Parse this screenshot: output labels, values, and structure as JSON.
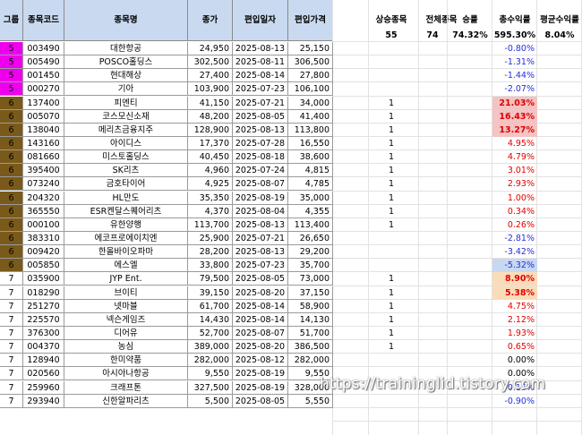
{
  "headers": {
    "group": "그룹",
    "code": "종목코드",
    "name": "종목명",
    "close": "종가",
    "date": "편입일자",
    "entry": "편입가격"
  },
  "summary": {
    "labels": [
      "상승종목",
      "전체종목",
      "승률",
      "총수익률",
      "평균수익률"
    ],
    "values": [
      "55",
      "74",
      "74.32%",
      "595.30%",
      "8.04%"
    ]
  },
  "colors": {
    "header_bg": "#c9daf0",
    "group5": "#ee00ee",
    "group6": "#7a5a1a",
    "pink_highlight": "#f4c3c3",
    "orange_highlight": "#fbdcb8",
    "blue_highlight": "#c8d8f0",
    "positive": "#e00000",
    "negative": "#2330d8"
  },
  "rows": [
    {
      "group": "5",
      "code": "003490",
      "name": "대한항공",
      "close": "24,950",
      "date": "2025-08-13",
      "entry": "25,150",
      "up": "",
      "ret": "-0.80%",
      "sign": "neg",
      "hl": ""
    },
    {
      "group": "5",
      "code": "005490",
      "name": "POSCO홀딩스",
      "close": "302,500",
      "date": "2025-08-11",
      "entry": "306,500",
      "up": "",
      "ret": "-1.31%",
      "sign": "neg",
      "hl": ""
    },
    {
      "group": "5",
      "code": "001450",
      "name": "현대해상",
      "close": "27,400",
      "date": "2025-08-14",
      "entry": "27,800",
      "up": "",
      "ret": "-1.44%",
      "sign": "neg",
      "hl": ""
    },
    {
      "group": "5",
      "code": "000270",
      "name": "기아",
      "close": "103,900",
      "date": "2025-07-23",
      "entry": "106,100",
      "up": "",
      "ret": "-2.07%",
      "sign": "neg",
      "hl": ""
    },
    {
      "group": "6",
      "code": "137400",
      "name": "피엔티",
      "close": "41,150",
      "date": "2025-07-21",
      "entry": "34,000",
      "up": "1",
      "ret": "21.03%",
      "sign": "pos",
      "hl": "pink"
    },
    {
      "group": "6",
      "code": "005070",
      "name": "코스모신소재",
      "close": "48,200",
      "date": "2025-08-05",
      "entry": "41,400",
      "up": "1",
      "ret": "16.43%",
      "sign": "pos",
      "hl": "pink"
    },
    {
      "group": "6",
      "code": "138040",
      "name": "메리츠금융지주",
      "close": "128,900",
      "date": "2025-08-13",
      "entry": "113,800",
      "up": "1",
      "ret": "13.27%",
      "sign": "pos",
      "hl": "pink"
    },
    {
      "group": "6",
      "code": "143160",
      "name": "아이디스",
      "close": "17,370",
      "date": "2025-07-28",
      "entry": "16,550",
      "up": "1",
      "ret": "4.95%",
      "sign": "pos",
      "hl": ""
    },
    {
      "group": "6",
      "code": "081660",
      "name": "미스토홀딩스",
      "close": "40,450",
      "date": "2025-08-18",
      "entry": "38,600",
      "up": "1",
      "ret": "4.79%",
      "sign": "pos",
      "hl": ""
    },
    {
      "group": "6",
      "code": "395400",
      "name": "SK리츠",
      "close": "4,960",
      "date": "2025-07-24",
      "entry": "4,815",
      "up": "1",
      "ret": "3.01%",
      "sign": "pos",
      "hl": ""
    },
    {
      "group": "6",
      "code": "073240",
      "name": "금호타이어",
      "close": "4,925",
      "date": "2025-08-07",
      "entry": "4,785",
      "up": "1",
      "ret": "2.93%",
      "sign": "pos",
      "hl": ""
    },
    {
      "group": "6",
      "code": "204320",
      "name": "HL만도",
      "close": "35,350",
      "date": "2025-08-19",
      "entry": "35,000",
      "up": "1",
      "ret": "1.00%",
      "sign": "pos",
      "hl": ""
    },
    {
      "group": "6",
      "code": "365550",
      "name": "ESR켄달스퀘어리츠",
      "close": "4,370",
      "date": "2025-08-04",
      "entry": "4,355",
      "up": "1",
      "ret": "0.34%",
      "sign": "pos",
      "hl": ""
    },
    {
      "group": "6",
      "code": "000100",
      "name": "유한양행",
      "close": "113,700",
      "date": "2025-08-13",
      "entry": "113,400",
      "up": "1",
      "ret": "0.26%",
      "sign": "pos",
      "hl": ""
    },
    {
      "group": "6",
      "code": "383310",
      "name": "에코프로에이치엔",
      "close": "25,900",
      "date": "2025-07-21",
      "entry": "26,650",
      "up": "",
      "ret": "-2.81%",
      "sign": "neg",
      "hl": ""
    },
    {
      "group": "6",
      "code": "009420",
      "name": "한올바이오파마",
      "close": "28,200",
      "date": "2025-08-13",
      "entry": "29,200",
      "up": "",
      "ret": "-3.42%",
      "sign": "neg",
      "hl": ""
    },
    {
      "group": "6",
      "code": "005850",
      "name": "에스엘",
      "close": "33,800",
      "date": "2025-07-23",
      "entry": "35,700",
      "up": "",
      "ret": "-5.32%",
      "sign": "neg",
      "hl": "blue"
    },
    {
      "group": "7",
      "code": "035900",
      "name": "JYP Ent.",
      "close": "79,500",
      "date": "2025-08-05",
      "entry": "73,000",
      "up": "1",
      "ret": "8.90%",
      "sign": "pos",
      "hl": "orange"
    },
    {
      "group": "7",
      "code": "018290",
      "name": "브이티",
      "close": "39,150",
      "date": "2025-08-20",
      "entry": "37,150",
      "up": "1",
      "ret": "5.38%",
      "sign": "pos",
      "hl": "orange"
    },
    {
      "group": "7",
      "code": "251270",
      "name": "넷마블",
      "close": "61,700",
      "date": "2025-08-14",
      "entry": "58,900",
      "up": "1",
      "ret": "4.75%",
      "sign": "pos",
      "hl": ""
    },
    {
      "group": "7",
      "code": "225570",
      "name": "넥슨게임즈",
      "close": "14,430",
      "date": "2025-08-14",
      "entry": "14,130",
      "up": "1",
      "ret": "2.12%",
      "sign": "pos",
      "hl": ""
    },
    {
      "group": "7",
      "code": "376300",
      "name": "디어유",
      "close": "52,700",
      "date": "2025-08-07",
      "entry": "51,700",
      "up": "1",
      "ret": "1.93%",
      "sign": "pos",
      "hl": ""
    },
    {
      "group": "7",
      "code": "004370",
      "name": "농심",
      "close": "389,000",
      "date": "2025-08-20",
      "entry": "386,500",
      "up": "1",
      "ret": "0.65%",
      "sign": "pos",
      "hl": ""
    },
    {
      "group": "7",
      "code": "128940",
      "name": "한미약품",
      "close": "282,000",
      "date": "2025-08-12",
      "entry": "282,000",
      "up": "",
      "ret": "0.00%",
      "sign": "zero",
      "hl": ""
    },
    {
      "group": "7",
      "code": "020560",
      "name": "아시아나항공",
      "close": "9,550",
      "date": "2025-08-19",
      "entry": "9,550",
      "up": "",
      "ret": "0.00%",
      "sign": "zero",
      "hl": ""
    },
    {
      "group": "7",
      "code": "259960",
      "name": "크래프톤",
      "close": "327,500",
      "date": "2025-08-19",
      "entry": "328,000",
      "up": "",
      "ret": "-0.15%",
      "sign": "neg",
      "hl": ""
    },
    {
      "group": "7",
      "code": "293940",
      "name": "신한알파리츠",
      "close": "5,500",
      "date": "2025-08-05",
      "entry": "5,550",
      "up": "",
      "ret": "-0.90%",
      "sign": "neg",
      "hl": ""
    }
  ],
  "watermark": "https://traininglid.tistory.com"
}
